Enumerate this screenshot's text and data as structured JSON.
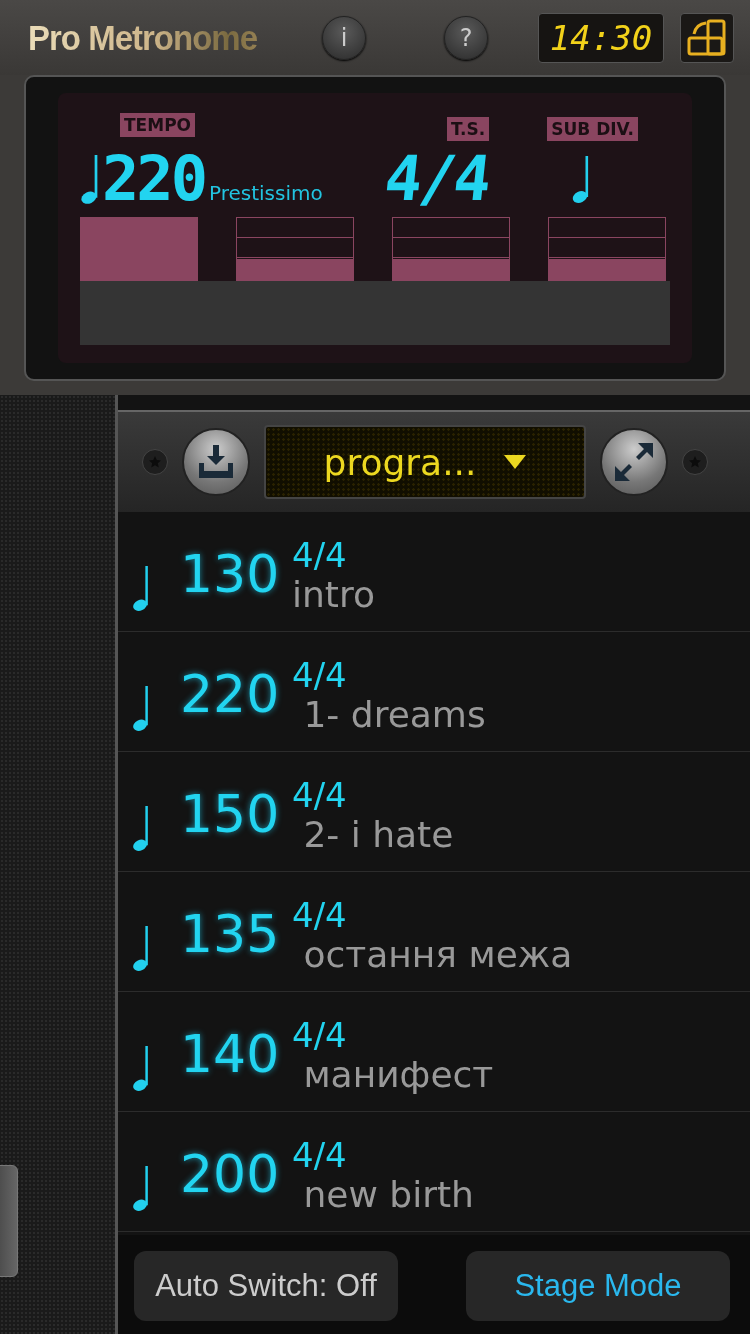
{
  "header": {
    "logo": "Pro Metronome",
    "info_button": "i",
    "help_button": "?",
    "clock": "14:30"
  },
  "display": {
    "tempo_label": "TEMPO",
    "ts_label": "T.S.",
    "subdiv_label": "SUB DIV.",
    "tempo": "220",
    "tempo_name": "Prestissimo",
    "time_signature": "4/4",
    "beats": [
      {
        "kind": "accent"
      },
      {
        "kind": "normal"
      },
      {
        "kind": "normal"
      },
      {
        "kind": "normal"
      }
    ]
  },
  "toolbar": {
    "program": "progra..."
  },
  "songs": [
    {
      "tempo": "130",
      "time_signature": "4/4",
      "name": "intro"
    },
    {
      "tempo": "220",
      "time_signature": "4/4",
      "name": " 1- dreams"
    },
    {
      "tempo": "150",
      "time_signature": "4/4",
      "name": " 2- i hate"
    },
    {
      "tempo": "135",
      "time_signature": "4/4",
      "name": " остання межа"
    },
    {
      "tempo": "140",
      "time_signature": "4/4",
      "name": " манифест"
    },
    {
      "tempo": "200",
      "time_signature": "4/4",
      "name": " new birth"
    }
  ],
  "bottom_bar": {
    "auto_switch": "Auto Switch: Off",
    "stage_mode": "Stage Mode"
  }
}
